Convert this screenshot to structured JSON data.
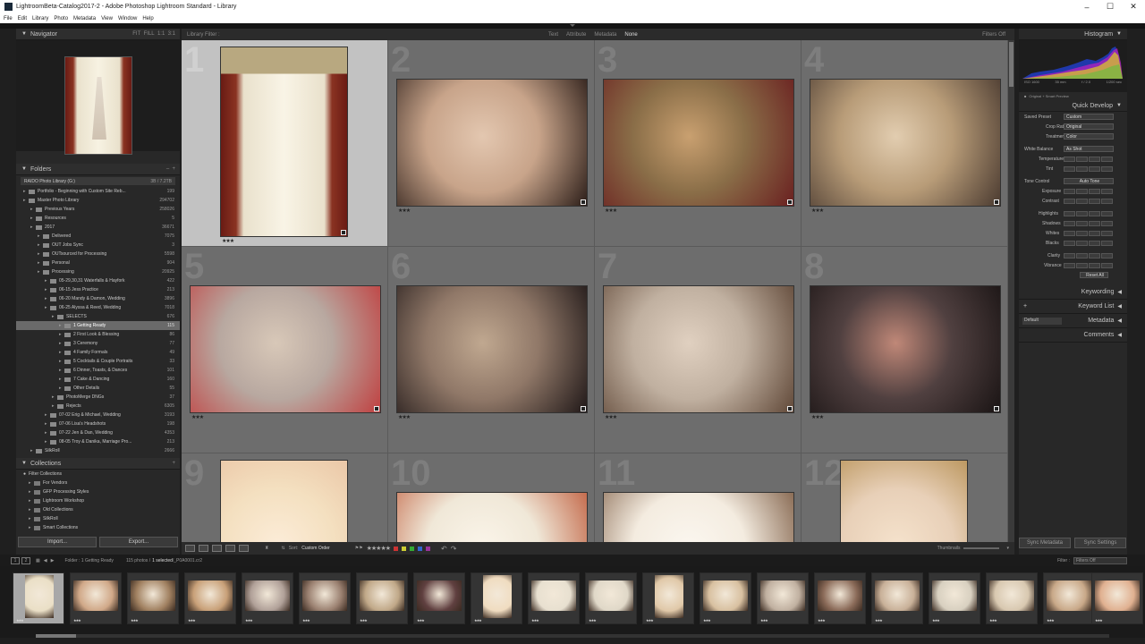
{
  "window": {
    "title": "LightroomBeta-Catalog2017-2 - Adobe Photoshop Lightroom Standard - Library"
  },
  "menu": [
    "File",
    "Edit",
    "Library",
    "Photo",
    "Metadata",
    "View",
    "Window",
    "Help"
  ],
  "navigator": {
    "title": "Navigator",
    "zooms": [
      "FIT",
      "FILL",
      "1:1",
      "3:1"
    ]
  },
  "folders": {
    "title": "Folders",
    "volume": {
      "label": "RAIDO Photo Library (G:)",
      "count": "3B / 7.2TB"
    },
    "items": [
      {
        "ind": 0,
        "label": "Portfolio - Beginning with Custom Site Reb...",
        "count": "199",
        "sel": false
      },
      {
        "ind": 0,
        "label": "Master Photo Library",
        "count": "294702",
        "sel": false
      },
      {
        "ind": 1,
        "label": "Previous Years",
        "count": "258026",
        "sel": false
      },
      {
        "ind": 1,
        "label": "Resources",
        "count": "5",
        "sel": false
      },
      {
        "ind": 1,
        "label": "2017",
        "count": "36671",
        "sel": false
      },
      {
        "ind": 2,
        "label": "Delivered",
        "count": "7075",
        "sel": false
      },
      {
        "ind": 2,
        "label": "OUT Jobs Sync",
        "count": "3",
        "sel": false
      },
      {
        "ind": 2,
        "label": "OUTsourced for Processing",
        "count": "5598",
        "sel": false
      },
      {
        "ind": 2,
        "label": "Personal",
        "count": "904",
        "sel": false
      },
      {
        "ind": 2,
        "label": "Processing",
        "count": "20925",
        "sel": false
      },
      {
        "ind": 3,
        "label": "05-29,30,31 Waterfalls & Hayfork",
        "count": "422",
        "sel": false
      },
      {
        "ind": 3,
        "label": "06-15 Jess Practice",
        "count": "213",
        "sel": false
      },
      {
        "ind": 3,
        "label": "06-20 Mandy & Damon, Wedding",
        "count": "3896",
        "sel": false
      },
      {
        "ind": 3,
        "label": "06-25 Alyssa & Reed, Wedding",
        "count": "7018",
        "sel": false
      },
      {
        "ind": 4,
        "label": "SELECTS",
        "count": "676",
        "sel": false
      },
      {
        "ind": 5,
        "label": "1 Getting Ready",
        "count": "115",
        "sel": true
      },
      {
        "ind": 5,
        "label": "2 First Look & Blessing",
        "count": "86",
        "sel": false
      },
      {
        "ind": 5,
        "label": "3 Ceremony",
        "count": "77",
        "sel": false
      },
      {
        "ind": 5,
        "label": "4 Family Formals",
        "count": "49",
        "sel": false
      },
      {
        "ind": 5,
        "label": "5 Cocktails & Couple Portraits",
        "count": "33",
        "sel": false
      },
      {
        "ind": 5,
        "label": "6 Dinner, Toasts, & Dances",
        "count": "101",
        "sel": false
      },
      {
        "ind": 5,
        "label": "7 Cake & Dancing",
        "count": "160",
        "sel": false
      },
      {
        "ind": 5,
        "label": "Other Details",
        "count": "55",
        "sel": false
      },
      {
        "ind": 4,
        "label": "PhotoMerge DNGs",
        "count": "37",
        "sel": false
      },
      {
        "ind": 4,
        "label": "Rejects",
        "count": "6305",
        "sel": false
      },
      {
        "ind": 3,
        "label": "07-02 Erig & Michael, Wedding",
        "count": "3193",
        "sel": false
      },
      {
        "ind": 3,
        "label": "07-06 Lisa's Headshots",
        "count": "198",
        "sel": false
      },
      {
        "ind": 3,
        "label": "07-22 Jen & Dan, Wedding",
        "count": "4353",
        "sel": false
      },
      {
        "ind": 3,
        "label": "08-05 Troy & Danika, Marriage Pro...",
        "count": "213",
        "sel": false
      },
      {
        "ind": 1,
        "label": "SilkRoll",
        "count": "2666",
        "sel": false
      }
    ]
  },
  "collections": {
    "title": "Collections",
    "filter": "Filter Collections",
    "items": [
      "For Vendors",
      "GFP Processing Styles",
      "Lightroom Workshop",
      "Old Collections",
      "SilkRoll",
      "Smart Collections"
    ]
  },
  "import_label": "Import...",
  "export_label": "Export...",
  "filter": {
    "label": "Library Filter :",
    "options": [
      "Text",
      "Attribute",
      "Metadata",
      "None"
    ],
    "active": "None",
    "filters_off": "Filters Off"
  },
  "grid": {
    "cells": [
      "1",
      "2",
      "3",
      "4",
      "5",
      "6",
      "7",
      "8",
      "9",
      "10",
      "11",
      "12"
    ],
    "stars": "★★★"
  },
  "toolbar": {
    "sort_label": "Sort:",
    "sort_value": "Custom Order",
    "thumbnails": "Thumbnails",
    "stars": "★★★★★"
  },
  "histogram": {
    "title": "Histogram",
    "iso": "ISO 1600",
    "focal": "35 mm",
    "fstop": "f / 2.0",
    "shutter": "1/200 sec",
    "preview": "Original + Smart Preview"
  },
  "quick_develop": {
    "title": "Quick Develop",
    "saved_preset": {
      "label": "Saved Preset",
      "value": "Custom"
    },
    "crop_ratio": {
      "label": "Crop Ratio",
      "value": "Original"
    },
    "treatment": {
      "label": "Treatment",
      "value": "Color"
    },
    "white_balance": {
      "label": "White Balance",
      "value": "As Shot"
    },
    "temperature": "Temperature",
    "tint": "Tint",
    "tone_control": "Tone Control",
    "auto_tone": "Auto Tone",
    "exposure": "Exposure",
    "contrast": "Contrast",
    "highlights": "Highlights",
    "shadows": "Shadows",
    "whites": "Whites",
    "blacks": "Blacks",
    "clarity": "Clarity",
    "vibrance": "Vibrance",
    "reset_all": "Reset All"
  },
  "right_panels": {
    "keywording": "Keywording",
    "keyword_list": "Keyword List",
    "metadata": "Metadata",
    "metadata_preset": "Default",
    "comments": "Comments"
  },
  "sync": {
    "metadata": "Sync Metadata",
    "settings": "Sync Settings"
  },
  "filmstrip": {
    "page1": "1",
    "page2": "2",
    "folder": "Folder : 1 Getting Ready",
    "count": "115 photos /",
    "selected": "1 selected",
    "file": "/_P0A0001.cr2",
    "filter_label": "Filter :",
    "filter_value": "Filters Off",
    "stars": "★★★"
  }
}
